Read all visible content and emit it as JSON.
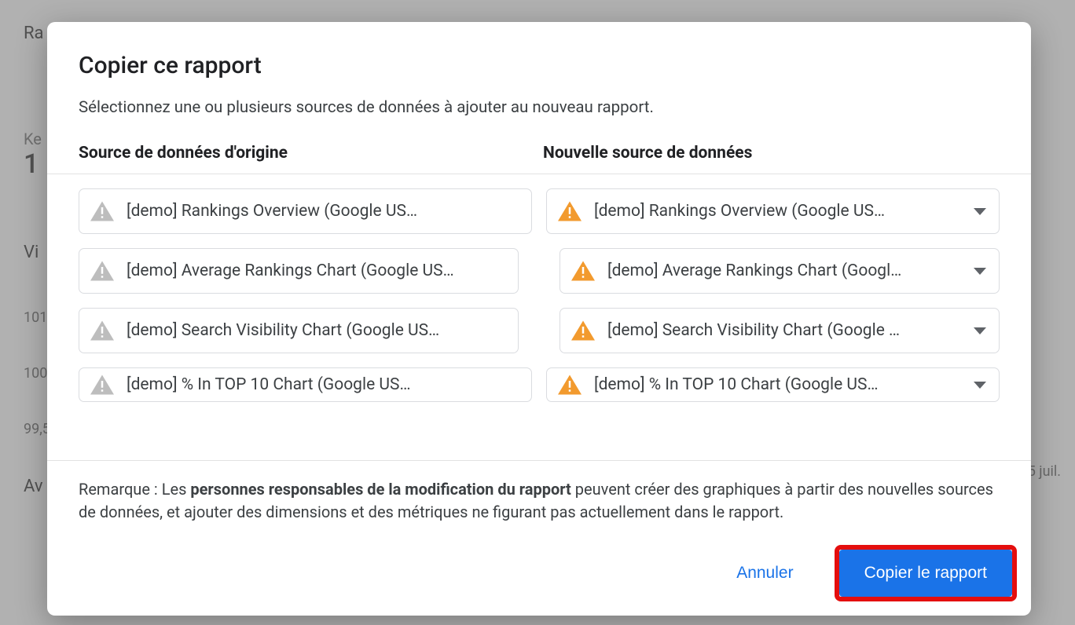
{
  "bg": {
    "r1": "Ra",
    "k": "Ke",
    "big": "1",
    "vi": "Vi",
    "t1": "101",
    "t2": "100",
    "t3": "99,5",
    "av": "Av",
    "date": "5 juil."
  },
  "modal": {
    "title": "Copier ce rapport",
    "description": "Sélectionnez une ou plusieurs sources de données à ajouter au nouveau rapport.",
    "col_origin": "Source de données d'origine",
    "col_new": "Nouvelle source de données",
    "note_prefix": "Remarque : Les ",
    "note_bold": "personnes responsables de la modification du rapport",
    "note_suffix": " peuvent créer des graphiques à partir des nouvelles sources de données, et ajouter des dimensions et des métriques ne figurant pas actuellement dans le rapport.",
    "cancel": "Annuler",
    "copy": "Copier le rapport"
  },
  "rows": [
    {
      "origin": "[demo] Rankings Overview (Google US…",
      "new": "[demo] Rankings Overview (Google US…",
      "indent": false
    },
    {
      "origin": "[demo] Average Rankings Chart (Google US…",
      "new": "[demo] Average Rankings Chart (Googl…",
      "indent": true
    },
    {
      "origin": "[demo] Search Visibility Chart (Google US…",
      "new": "[demo] Search Visibility Chart (Google …",
      "indent": true
    },
    {
      "origin": "[demo] % In TOP 10 Chart (Google US…",
      "new": "[demo] % In TOP 10 Chart (Google US…",
      "indent": false
    }
  ]
}
